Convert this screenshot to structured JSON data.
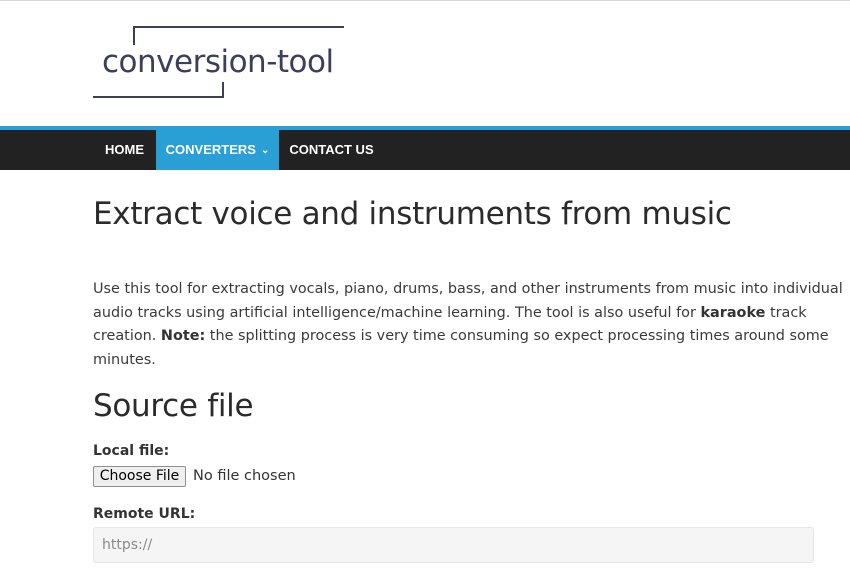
{
  "logo": {
    "text": "conversion-tool"
  },
  "nav": {
    "items": [
      {
        "label": "HOME"
      },
      {
        "label": "CONVERTERS",
        "active": true,
        "has_dropdown": true
      },
      {
        "label": "CONTACT US"
      }
    ]
  },
  "main": {
    "title": "Extract voice and instruments from music",
    "intro": {
      "part1": "Use this tool for extracting vocals, piano, drums, bass, and other instruments from music into individual audio tracks using artificial intelligence/machine learning. The tool is also useful for ",
      "bold1": "karaoke",
      "part2": " track creation. ",
      "bold2": "Note:",
      "part3": " the splitting process is very time consuming so expect processing times around some minutes."
    },
    "section_title": "Source file",
    "local_file": {
      "label": "Local file:",
      "button_label": "Choose File",
      "status": "No file chosen"
    },
    "remote_url": {
      "label": "Remote URL:",
      "placeholder": "https://",
      "value": ""
    }
  },
  "colors": {
    "accent": "#2a9fd6",
    "nav_bg": "#222222",
    "logo_text": "#3c3f5a"
  },
  "icons": {
    "dropdown": "chevron-down-icon"
  }
}
